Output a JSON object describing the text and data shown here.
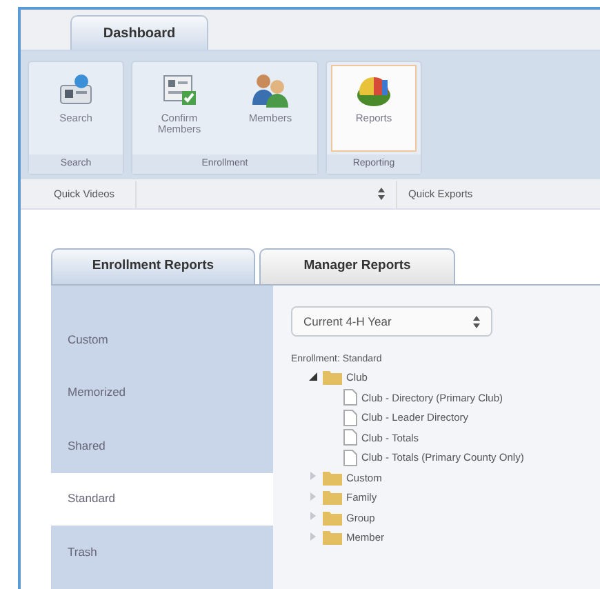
{
  "top_tabs": [
    {
      "label": "Dashboard",
      "selected": true
    }
  ],
  "ribbon": {
    "groups": [
      {
        "label": "Search",
        "buttons": [
          {
            "label": "Search",
            "selected": false
          }
        ]
      },
      {
        "label": "Enrollment",
        "buttons": [
          {
            "label": "Confirm Members",
            "selected": false
          },
          {
            "label": "Members",
            "selected": false
          }
        ]
      },
      {
        "label": "Reporting",
        "buttons": [
          {
            "label": "Reports",
            "selected": true
          }
        ]
      }
    ]
  },
  "quick_bar": {
    "videos_label": "Quick Videos",
    "exports_label": "Quick Exports"
  },
  "report_tabs": [
    {
      "label": "Enrollment Reports",
      "selected": true
    },
    {
      "label": "Manager Reports",
      "selected": false
    }
  ],
  "sidebar": {
    "items": [
      {
        "label": "Custom",
        "selected": false
      },
      {
        "label": "Memorized",
        "selected": false
      },
      {
        "label": "Shared",
        "selected": false
      },
      {
        "label": "Standard",
        "selected": true
      },
      {
        "label": "Trash",
        "selected": false
      }
    ]
  },
  "year_select": {
    "value": "Current 4-H Year"
  },
  "tree_caption": "Enrollment: Standard",
  "tree": [
    {
      "label": "Club",
      "kind": "folder",
      "expanded": true,
      "children": [
        {
          "label": "Club - Directory (Primary Club)",
          "kind": "report"
        },
        {
          "label": "Club - Leader Directory",
          "kind": "report"
        },
        {
          "label": "Club - Totals",
          "kind": "report"
        },
        {
          "label": "Club - Totals (Primary County Only)",
          "kind": "report"
        }
      ]
    },
    {
      "label": "Custom",
      "kind": "folder",
      "expanded": false
    },
    {
      "label": "Family",
      "kind": "folder",
      "expanded": false
    },
    {
      "label": "Group",
      "kind": "folder",
      "expanded": false
    },
    {
      "label": "Member",
      "kind": "folder",
      "expanded": false
    }
  ]
}
